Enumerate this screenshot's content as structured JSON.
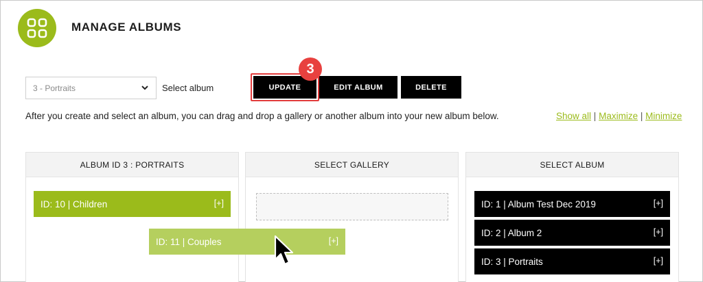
{
  "header": {
    "title": "MANAGE ALBUMS",
    "logo_icon": "grid-icon",
    "accent_color": "#9bbb1b"
  },
  "toolbar": {
    "album_select_value": "3 - Portraits",
    "select_label": "Select album",
    "update_label": "UPDATE",
    "edit_label": "EDIT ALBUM",
    "delete_label": "DELETE",
    "step_badge": "3"
  },
  "instructions": "After you create and select an album, you can drag and drop a gallery or another album into your new album below.",
  "view_links": {
    "show_all": "Show all",
    "maximize": "Maximize",
    "minimize": "Minimize",
    "separator": "|"
  },
  "panels": {
    "album": {
      "title": "ALBUM ID 3 : PORTRAITS",
      "items": [
        {
          "label": "ID: 10 | Children",
          "action": "[+]"
        }
      ],
      "dragging": {
        "label": "ID: 11 | Couples",
        "action": "[+]"
      }
    },
    "gallery": {
      "title": "SELECT GALLERY"
    },
    "select_album": {
      "title": "SELECT ALBUM",
      "items": [
        {
          "label": "ID: 1 | Album Test Dec 2019",
          "action": "[+]"
        },
        {
          "label": "ID: 2 | Album 2",
          "action": "[+]"
        },
        {
          "label": "ID: 3 | Portraits",
          "action": "[+]"
        }
      ]
    }
  }
}
